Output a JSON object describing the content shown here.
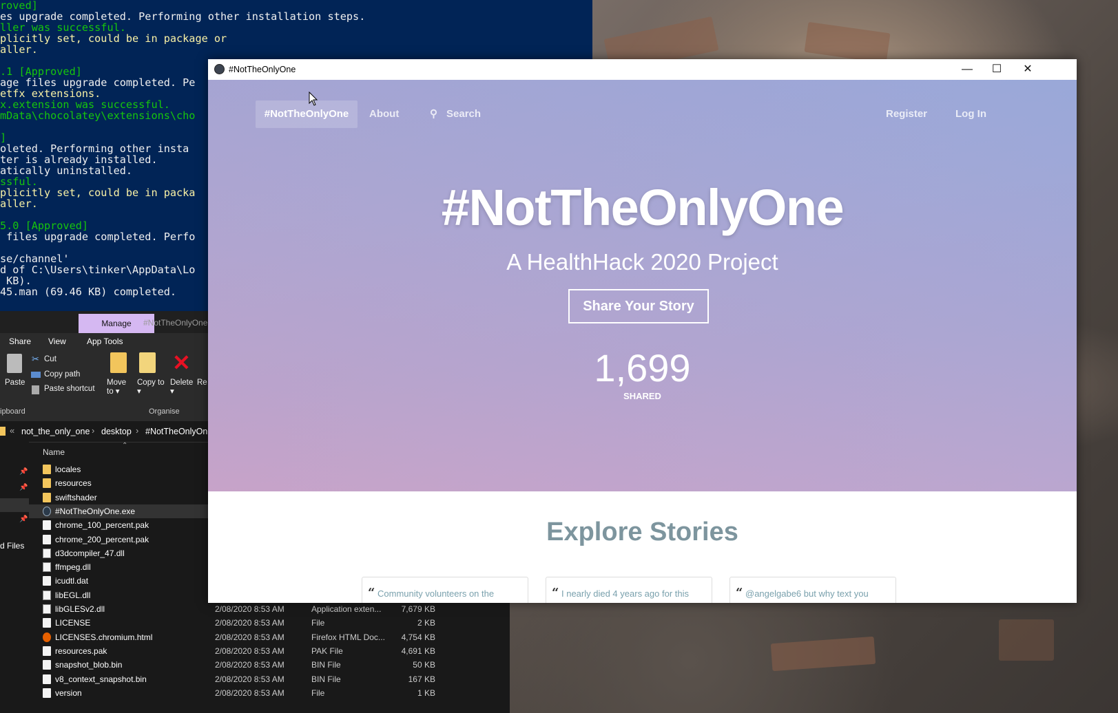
{
  "terminal": {
    "lines": [
      {
        "text": "roved]",
        "color": "green"
      },
      {
        "text": "es upgrade completed. Performing other installation steps.",
        "color": "white"
      },
      {
        "text": "ller was successful.",
        "color": "green"
      },
      {
        "text": "plicitly set, could be in package or",
        "color": "yellow"
      },
      {
        "text": "aller.",
        "color": "yellow"
      },
      {
        "text": "",
        "color": "white"
      },
      {
        "text": ".1 [Approved]",
        "color": "green"
      },
      {
        "text": "age files upgrade completed. Pe",
        "color": "white"
      },
      {
        "text": "etfx extensions.",
        "color": "yellow"
      },
      {
        "text": "x.extension was successful.",
        "color": "green"
      },
      {
        "text": "mData\\chocolatey\\extensions\\cho",
        "color": "green"
      },
      {
        "text": "",
        "color": "white"
      },
      {
        "text": "]",
        "color": "green"
      },
      {
        "text": "oleted. Performing other insta",
        "color": "white"
      },
      {
        "text": "ter is already installed.",
        "color": "white"
      },
      {
        "text": "atically uninstalled.",
        "color": "white"
      },
      {
        "text": "ssful.",
        "color": "green"
      },
      {
        "text": "plicitly set, could be in packa",
        "color": "yellow"
      },
      {
        "text": "aller.",
        "color": "yellow"
      },
      {
        "text": "",
        "color": "white"
      },
      {
        "text": "5.0 [Approved]",
        "color": "green"
      },
      {
        "text": " files upgrade completed. Perfo",
        "color": "white"
      },
      {
        "text": "",
        "color": "white"
      },
      {
        "text": "se/channel'",
        "color": "white"
      },
      {
        "text": "d of C:\\Users\\tinker\\AppData\\Lo",
        "color": "white"
      },
      {
        "text": " KB).",
        "color": "white"
      },
      {
        "text": "45.man (69.46 KB) completed.",
        "color": "white"
      }
    ]
  },
  "explorer": {
    "context_tab": "Manage",
    "window_title": "#NotTheOnlyOne",
    "ribbon_tabs": [
      "Share",
      "View",
      "App Tools"
    ],
    "ribbon": {
      "paste": "Paste",
      "cut": "Cut",
      "copy_path": "Copy path",
      "paste_shortcut": "Paste shortcut",
      "move_to": "Move to ▾",
      "copy_to": "Copy to ▾",
      "delete": "Delete ▾",
      "rename": "Re",
      "group_clipboard": "ipboard",
      "group_organise": "Organise"
    },
    "breadcrumb": [
      "not_the_only_one",
      "desktop",
      "#NotTheOnlyOne"
    ],
    "nav_label": "d Files",
    "column_name": "Name",
    "files": [
      {
        "name": "locales",
        "date": "",
        "type": "",
        "size": "",
        "icon": "folder"
      },
      {
        "name": "resources",
        "date": "",
        "type": "",
        "size": "",
        "icon": "folder"
      },
      {
        "name": "swiftshader",
        "date": "",
        "type": "",
        "size": "",
        "icon": "folder"
      },
      {
        "name": "#NotTheOnlyOne.exe",
        "date": "",
        "type": "",
        "size": "",
        "icon": "exe"
      },
      {
        "name": "chrome_100_percent.pak",
        "date": "",
        "type": "",
        "size": "",
        "icon": "file"
      },
      {
        "name": "chrome_200_percent.pak",
        "date": "",
        "type": "",
        "size": "",
        "icon": "file"
      },
      {
        "name": "d3dcompiler_47.dll",
        "date": "",
        "type": "",
        "size": "",
        "icon": "dll"
      },
      {
        "name": "ffmpeg.dll",
        "date": "",
        "type": "",
        "size": "",
        "icon": "dll"
      },
      {
        "name": "icudtl.dat",
        "date": "",
        "type": "",
        "size": "",
        "icon": "file"
      },
      {
        "name": "libEGL.dll",
        "date": "",
        "type": "",
        "size": "",
        "icon": "dll"
      },
      {
        "name": "libGLESv2.dll",
        "date": "2/08/2020 8:53 AM",
        "type": "Application exten...",
        "size": "7,679 KB",
        "icon": "dll"
      },
      {
        "name": "LICENSE",
        "date": "2/08/2020 8:53 AM",
        "type": "File",
        "size": "2 KB",
        "icon": "file"
      },
      {
        "name": "LICENSES.chromium.html",
        "date": "2/08/2020 8:53 AM",
        "type": "Firefox HTML Doc...",
        "size": "4,754 KB",
        "icon": "firefox"
      },
      {
        "name": "resources.pak",
        "date": "2/08/2020 8:53 AM",
        "type": "PAK File",
        "size": "4,691 KB",
        "icon": "file"
      },
      {
        "name": "snapshot_blob.bin",
        "date": "2/08/2020 8:53 AM",
        "type": "BIN File",
        "size": "50 KB",
        "icon": "file"
      },
      {
        "name": "v8_context_snapshot.bin",
        "date": "2/08/2020 8:53 AM",
        "type": "BIN File",
        "size": "167 KB",
        "icon": "file"
      },
      {
        "name": "version",
        "date": "2/08/2020 8:53 AM",
        "type": "File",
        "size": "1 KB",
        "icon": "file"
      }
    ]
  },
  "app": {
    "window_title": "#NotTheOnlyOne",
    "window_buttons": {
      "minimize": "—",
      "maximize": "☐",
      "close": "✕"
    },
    "nav": {
      "brand": "#NotTheOnlyOne",
      "about": "About",
      "search": "Search",
      "register": "Register",
      "login": "Log In"
    },
    "hero": {
      "title": "#NotTheOnlyOne",
      "subtitle": "A HealthHack 2020 Project",
      "cta": "Share Your Story",
      "count": "1,699",
      "count_label": "SHARED"
    },
    "explore": {
      "title": "Explore Stories",
      "stories": [
        "Community volunteers on the",
        "I nearly died 4 years ago for this",
        "@angelgabe6 but why text you"
      ]
    }
  }
}
